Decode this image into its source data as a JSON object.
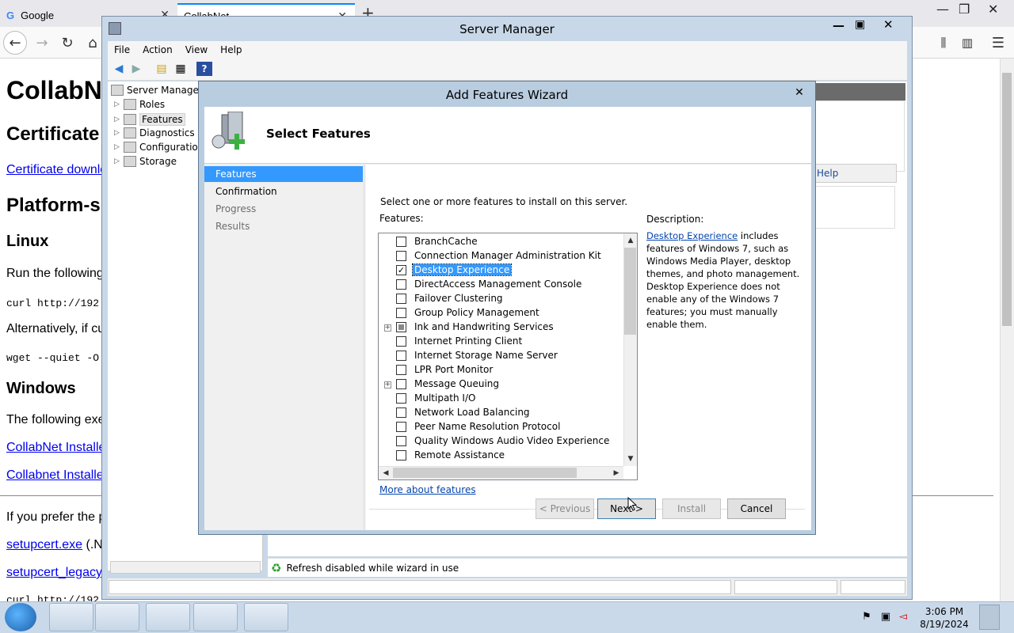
{
  "browser": {
    "tabs": [
      {
        "label": "Google",
        "favicon": "G"
      },
      {
        "label": "CollabNet"
      }
    ],
    "new_tab": "+"
  },
  "webpage": {
    "title": "CollabN",
    "h_certificate": "Certificate",
    "link_cert_download": "Certificate downlo",
    "h_platform": "Platform-s",
    "h_linux": "Linux",
    "p_run": "Run the following",
    "code_curl": "curl http://192",
    "p_alternatively": "Alternatively, if cu",
    "code_wget": "wget --quiet -O",
    "h_windows": "Windows",
    "p_following": "The following exe",
    "link_installer1": "CollabNet Installe",
    "link_installer2": "Collabnet Installer",
    "p_prefer": "If you prefer the pr",
    "link_setupcert": "setupcert.exe",
    "setupcert_suffix": " (.NE",
    "link_setupcert_legacy": "setupcert_legacy",
    "code_curl2": "curl http://192"
  },
  "server_manager": {
    "title": "Server Manager",
    "menu": [
      "File",
      "Action",
      "View",
      "Help"
    ],
    "tree": {
      "root": "Server Manager (",
      "items": [
        "Roles",
        "Features",
        "Diagnostics",
        "Configuration",
        "Storage"
      ]
    },
    "help_link": "Help",
    "status": "Refresh disabled while wizard in use"
  },
  "wizard": {
    "title": "Add Features Wizard",
    "heading": "Select Features",
    "steps": [
      {
        "label": "Features",
        "state": "active"
      },
      {
        "label": "Confirmation",
        "state": "normal"
      },
      {
        "label": "Progress",
        "state": "disabled"
      },
      {
        "label": "Results",
        "state": "disabled"
      }
    ],
    "instruction": "Select one or more features to install on this server.",
    "features_label": "Features:",
    "features": [
      {
        "label": "BranchCache",
        "checked": false,
        "expandable": false
      },
      {
        "label": "Connection Manager Administration Kit",
        "checked": false,
        "expandable": false
      },
      {
        "label": "Desktop Experience",
        "checked": true,
        "expandable": false,
        "selected": true
      },
      {
        "label": "DirectAccess Management Console",
        "checked": false,
        "expandable": false
      },
      {
        "label": "Failover Clustering",
        "checked": false,
        "expandable": false
      },
      {
        "label": "Group Policy Management",
        "checked": false,
        "expandable": false
      },
      {
        "label": "Ink and Handwriting Services",
        "checked": "partial",
        "expandable": true
      },
      {
        "label": "Internet Printing Client",
        "checked": false,
        "expandable": false
      },
      {
        "label": "Internet Storage Name Server",
        "checked": false,
        "expandable": false
      },
      {
        "label": "LPR Port Monitor",
        "checked": false,
        "expandable": false
      },
      {
        "label": "Message Queuing",
        "checked": false,
        "expandable": true
      },
      {
        "label": "Multipath I/O",
        "checked": false,
        "expandable": false
      },
      {
        "label": "Network Load Balancing",
        "checked": false,
        "expandable": false
      },
      {
        "label": "Peer Name Resolution Protocol",
        "checked": false,
        "expandable": false
      },
      {
        "label": "Quality Windows Audio Video Experience",
        "checked": false,
        "expandable": false
      },
      {
        "label": "Remote Assistance",
        "checked": false,
        "expandable": false
      }
    ],
    "description_label": "Description:",
    "description_link": "Desktop Experience",
    "description_lines": [
      " includes",
      "features of Windows 7, such as",
      "Windows Media Player, desktop",
      "themes, and photo management.",
      "Desktop Experience does not",
      "enable any of the Windows 7",
      "features; you must manually",
      "enable them."
    ],
    "more_link": "More about features",
    "buttons": {
      "previous": "< Previous",
      "next": "Next >",
      "install": "Install",
      "cancel": "Cancel"
    }
  },
  "taskbar": {
    "time": "3:06 PM",
    "date": "8/19/2024"
  },
  "colors": {
    "selection": "#3399ff",
    "link": "#0645ad",
    "window_frame": "#c8d8e8"
  }
}
